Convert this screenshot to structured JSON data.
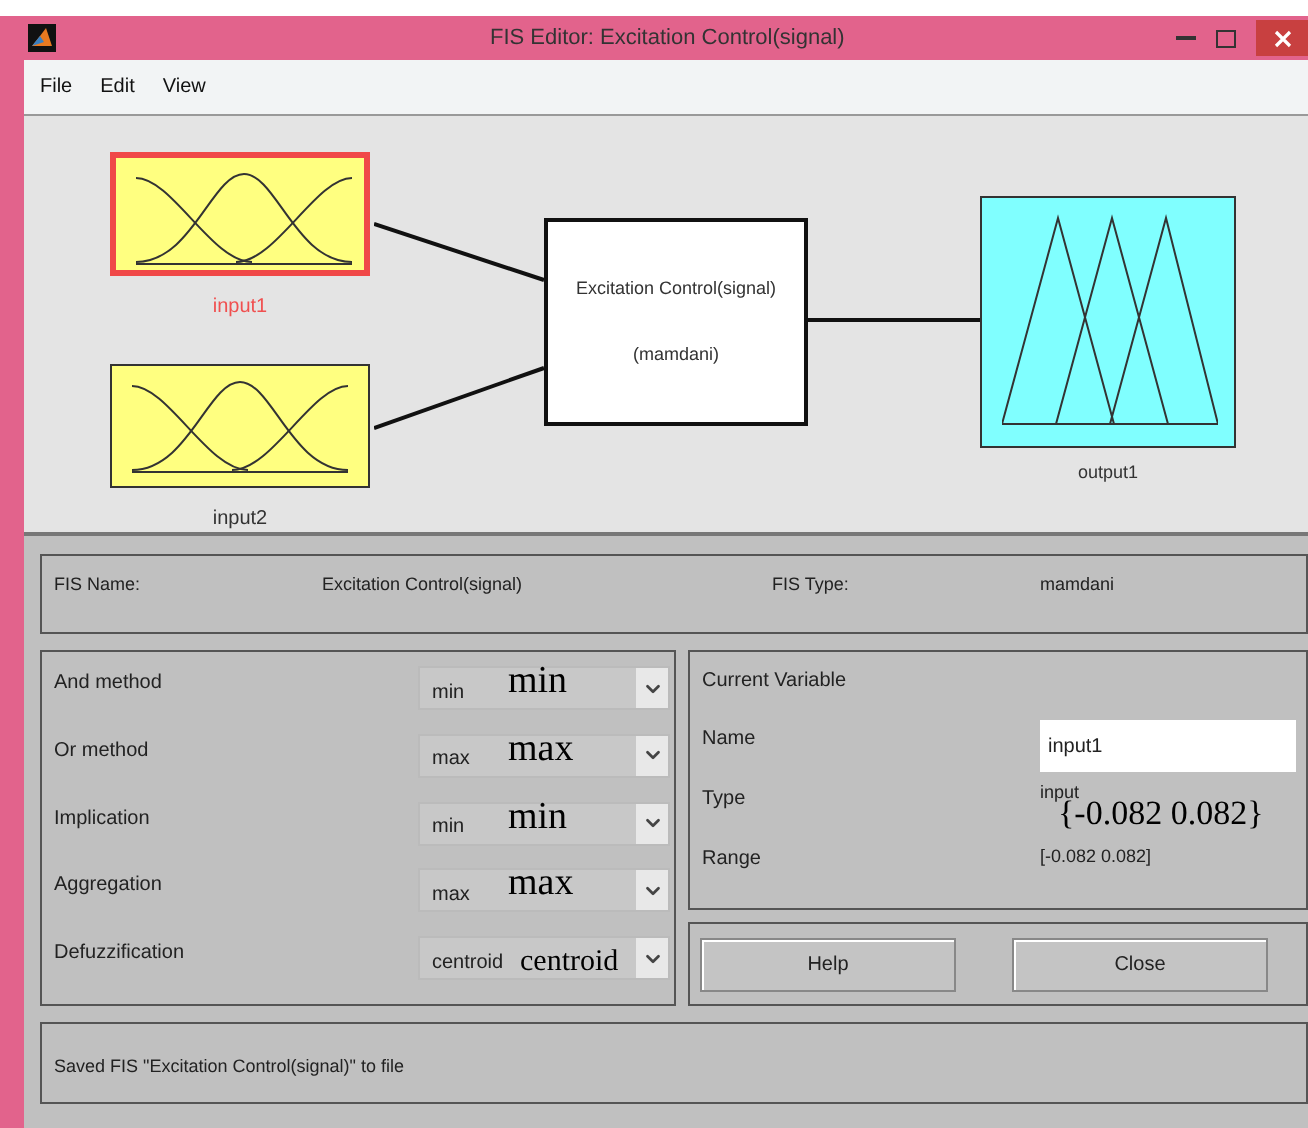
{
  "window": {
    "title": "FIS Editor: Excitation Control(signal)"
  },
  "menu": [
    {
      "label": "File"
    },
    {
      "label": "Edit"
    },
    {
      "label": "View"
    }
  ],
  "diagram": {
    "inputs": [
      {
        "label": "input1",
        "selected": true
      },
      {
        "label": "input2",
        "selected": false
      }
    ],
    "system": {
      "name": "Excitation Control(signal)",
      "type": "(mamdani)"
    },
    "outputs": [
      {
        "label": "output1",
        "selected": false
      }
    ]
  },
  "fis": {
    "name_label": "FIS Name:",
    "name": "Excitation Control(signal)",
    "type_label": "FIS Type:",
    "type": "mamdani"
  },
  "methods": [
    {
      "label": "And method",
      "value": "min",
      "annotation": "min"
    },
    {
      "label": "Or method",
      "value": "max",
      "annotation": "max"
    },
    {
      "label": "Implication",
      "value": "min",
      "annotation": "min"
    },
    {
      "label": "Aggregation",
      "value": "max",
      "annotation": "max"
    },
    {
      "label": "Defuzzification",
      "value": "centroid",
      "annotation": "centroid"
    }
  ],
  "current_variable": {
    "title": "Current Variable",
    "name_label": "Name",
    "name": "input1",
    "type_label": "Type",
    "type": "input",
    "type_annotation": "{-0.082 0.082}",
    "range_label": "Range",
    "range": "[-0.082 0.082]"
  },
  "buttons": [
    "Help",
    "Close"
  ],
  "status": "Saved FIS \"Excitation Control(signal)\" to file"
}
